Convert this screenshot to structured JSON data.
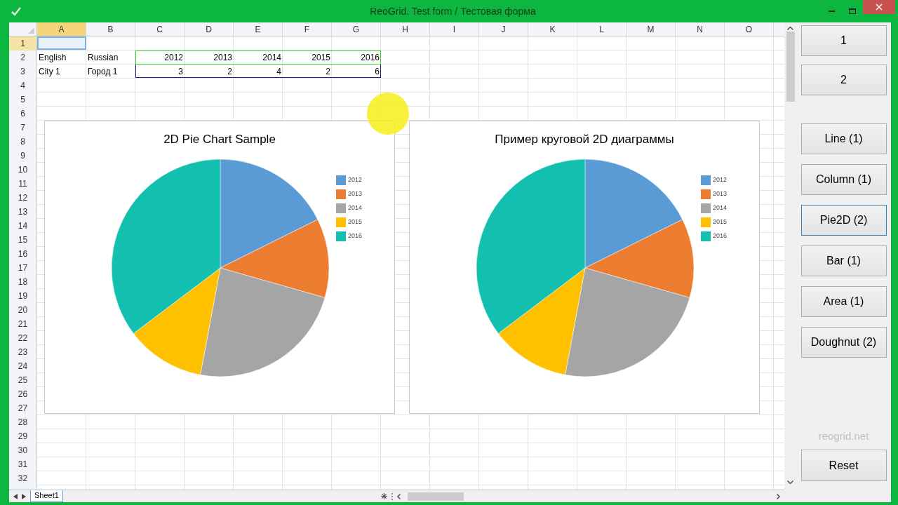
{
  "window": {
    "title": "ReoGrid. Test form / Тестовая форма"
  },
  "sheet": {
    "columns": [
      {
        "label": "A",
        "selected": true
      },
      {
        "label": "B",
        "selected": false
      },
      {
        "label": "C",
        "selected": false
      },
      {
        "label": "D",
        "selected": false
      },
      {
        "label": "E",
        "selected": false
      },
      {
        "label": "F",
        "selected": false
      },
      {
        "label": "G",
        "selected": false
      },
      {
        "label": "H",
        "selected": false
      },
      {
        "label": "I",
        "selected": false
      },
      {
        "label": "J",
        "selected": false
      },
      {
        "label": "K",
        "selected": false
      },
      {
        "label": "L",
        "selected": false
      },
      {
        "label": "M",
        "selected": false
      },
      {
        "label": "N",
        "selected": false
      },
      {
        "label": "O",
        "selected": false
      }
    ],
    "rows": [
      {
        "label": "1",
        "selected": true,
        "cells": []
      },
      {
        "label": "2",
        "selected": false,
        "cells": [
          {
            "kind": "text",
            "text": "English"
          },
          {
            "kind": "text",
            "text": "Russian"
          },
          {
            "kind": "number",
            "text": "2012"
          },
          {
            "kind": "number",
            "text": "2013"
          },
          {
            "kind": "number",
            "text": "2014"
          },
          {
            "kind": "number",
            "text": "2015"
          },
          {
            "kind": "number",
            "text": "2016"
          }
        ]
      },
      {
        "label": "3",
        "selected": false,
        "cells": [
          {
            "kind": "text",
            "text": "City 1"
          },
          {
            "kind": "text",
            "text": "Город 1"
          },
          {
            "kind": "number",
            "text": "3"
          },
          {
            "kind": "number",
            "text": "2"
          },
          {
            "kind": "number",
            "text": "4"
          },
          {
            "kind": "number",
            "text": "2"
          },
          {
            "kind": "number",
            "text": "6"
          }
        ]
      },
      {
        "label": "4",
        "selected": false,
        "cells": []
      },
      {
        "label": "5",
        "selected": false,
        "cells": []
      },
      {
        "label": "6",
        "selected": false,
        "cells": []
      },
      {
        "label": "7",
        "selected": false,
        "cells": []
      },
      {
        "label": "8",
        "selected": false,
        "cells": []
      },
      {
        "label": "9",
        "selected": false,
        "cells": []
      },
      {
        "label": "10",
        "selected": false,
        "cells": []
      },
      {
        "label": "11",
        "selected": false,
        "cells": []
      },
      {
        "label": "12",
        "selected": false,
        "cells": []
      },
      {
        "label": "13",
        "selected": false,
        "cells": []
      },
      {
        "label": "14",
        "selected": false,
        "cells": []
      },
      {
        "label": "15",
        "selected": false,
        "cells": []
      },
      {
        "label": "16",
        "selected": false,
        "cells": []
      },
      {
        "label": "17",
        "selected": false,
        "cells": []
      },
      {
        "label": "18",
        "selected": false,
        "cells": []
      },
      {
        "label": "19",
        "selected": false,
        "cells": []
      },
      {
        "label": "20",
        "selected": false,
        "cells": []
      },
      {
        "label": "21",
        "selected": false,
        "cells": []
      },
      {
        "label": "22",
        "selected": false,
        "cells": []
      },
      {
        "label": "23",
        "selected": false,
        "cells": []
      },
      {
        "label": "24",
        "selected": false,
        "cells": []
      },
      {
        "label": "25",
        "selected": false,
        "cells": []
      },
      {
        "label": "26",
        "selected": false,
        "cells": []
      },
      {
        "label": "27",
        "selected": false,
        "cells": []
      },
      {
        "label": "28",
        "selected": false,
        "cells": []
      },
      {
        "label": "29",
        "selected": false,
        "cells": []
      },
      {
        "label": "30",
        "selected": false,
        "cells": []
      },
      {
        "label": "31",
        "selected": false,
        "cells": []
      },
      {
        "label": "32",
        "selected": false,
        "cells": []
      }
    ]
  },
  "charts": [
    {
      "chart_data": {
        "type": "pie",
        "title": "2D Pie Chart Sample",
        "categories": [
          "2012",
          "2013",
          "2014",
          "2015",
          "2016"
        ],
        "values": [
          17.65,
          11.76,
          23.53,
          11.76,
          35.3
        ]
      }
    },
    {
      "chart_data": {
        "type": "pie",
        "title": "Пример круговой 2D диаграммы",
        "categories": [
          "2012",
          "2013",
          "2014",
          "2015",
          "2016"
        ],
        "values": [
          17.65,
          11.76,
          23.53,
          11.76,
          35.3
        ]
      }
    }
  ],
  "sheet_tabs": [
    {
      "label": "Sheet1",
      "selected": true
    }
  ],
  "side_buttons": [
    {
      "label": "1",
      "selected": false
    },
    {
      "label": "2",
      "selected": false
    },
    {
      "label": "Line (1)",
      "selected": false
    },
    {
      "label": "Column (1)",
      "selected": false
    },
    {
      "label": "Pie2D (2)",
      "selected": true
    },
    {
      "label": "Bar (1)",
      "selected": false
    },
    {
      "label": "Area (1)",
      "selected": false
    },
    {
      "label": "Doughnut (2)",
      "selected": false
    }
  ],
  "site_label": "reogrid.net",
  "reset_button": "Reset"
}
